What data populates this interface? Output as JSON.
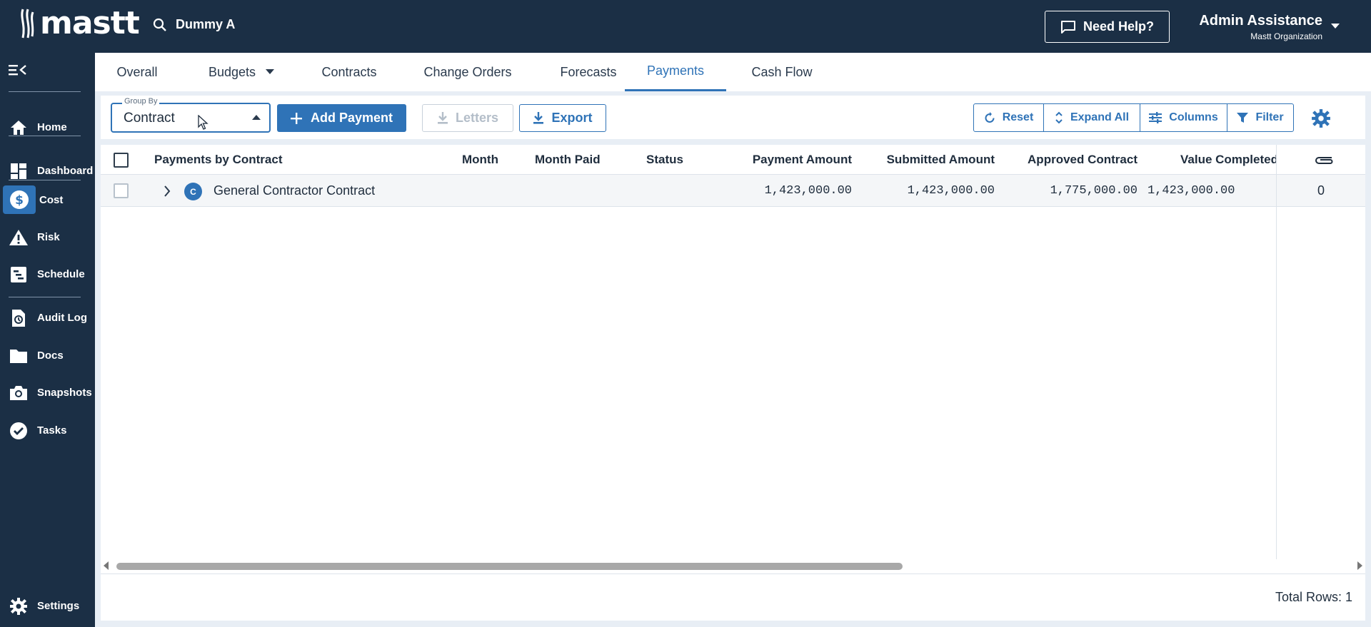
{
  "app": {
    "logo_text": "mastt",
    "search_text": "Dummy A"
  },
  "header": {
    "help_label": "Need Help?",
    "user_name": "Admin Assistance",
    "user_org": "Mastt Organization"
  },
  "sidebar": {
    "items": [
      {
        "label": "Home",
        "icon": "home-icon"
      },
      {
        "label": "Dashboard",
        "icon": "dashboard-icon"
      },
      {
        "label": "Cost",
        "icon": "dollar-icon"
      },
      {
        "label": "Risk",
        "icon": "warning-icon"
      },
      {
        "label": "Schedule",
        "icon": "schedule-icon"
      },
      {
        "label": "Audit Log",
        "icon": "audit-log-icon"
      },
      {
        "label": "Docs",
        "icon": "folder-icon"
      },
      {
        "label": "Snapshots",
        "icon": "camera-icon"
      },
      {
        "label": "Tasks",
        "icon": "check-circle-icon"
      },
      {
        "label": "Settings",
        "icon": "gear-icon"
      }
    ],
    "active": "Cost"
  },
  "tabs": [
    {
      "label": "Overall"
    },
    {
      "label": "Budgets"
    },
    {
      "label": "Contracts"
    },
    {
      "label": "Change Orders"
    },
    {
      "label": "Forecasts"
    },
    {
      "label": "Payments"
    },
    {
      "label": "Cash Flow"
    }
  ],
  "active_tab": "Payments",
  "toolbar": {
    "group_by_label": "Group By",
    "group_by_value": "Contract",
    "add_payment": "Add Payment",
    "letters": "Letters",
    "export": "Export",
    "reset": "Reset",
    "expand_all": "Expand All",
    "columns": "Columns",
    "filter": "Filter"
  },
  "table": {
    "headers": [
      "Payments by Contract",
      "Month",
      "Month Paid",
      "Status",
      "Payment Amount",
      "Submitted Amount",
      "Approved Contract",
      "Value Completed"
    ],
    "rows": [
      {
        "badge": "C",
        "name": "General Contractor Contract",
        "month": "",
        "month_paid": "",
        "status": "",
        "payment_amount": "1,423,000.00",
        "submitted_amount": "1,423,000.00",
        "approved_contract": "1,775,000.00",
        "value_completed": "1,423,000.00",
        "attachments": "0"
      }
    ]
  },
  "footer": {
    "total_rows": "Total Rows: 1"
  },
  "colors": {
    "navy": "#1b2f45",
    "accent": "#2f73b7"
  }
}
